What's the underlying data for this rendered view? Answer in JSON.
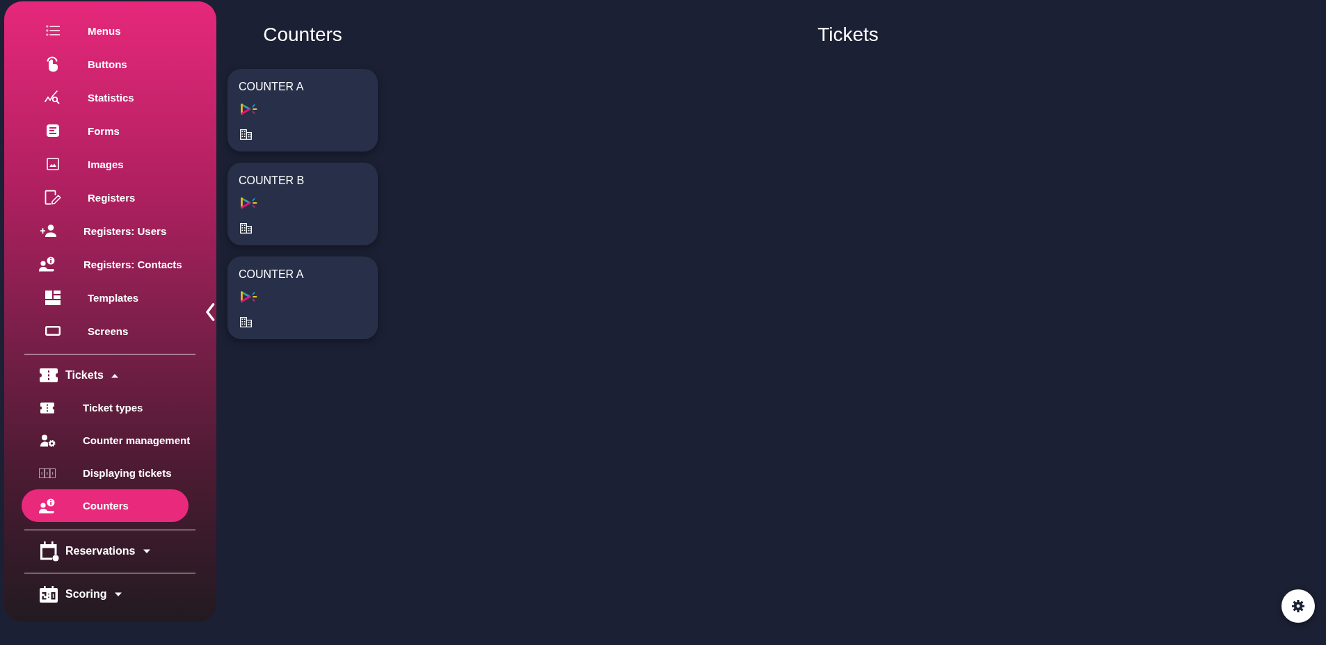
{
  "sidebar": {
    "items": [
      {
        "label": "Menus",
        "selected": false
      },
      {
        "label": "Buttons",
        "selected": false
      },
      {
        "label": "Statistics",
        "selected": false
      },
      {
        "label": "Forms",
        "selected": false
      },
      {
        "label": "Images",
        "selected": false
      },
      {
        "label": "Registers",
        "selected": false
      },
      {
        "label": "Registers: Users",
        "selected": false
      },
      {
        "label": "Registers: Contacts",
        "selected": false
      },
      {
        "label": "Templates",
        "selected": false
      },
      {
        "label": "Screens",
        "selected": false
      }
    ],
    "groups": [
      {
        "label": "Tickets",
        "expanded": true,
        "children": [
          {
            "label": "Ticket types",
            "selected": false
          },
          {
            "label": "Counter management",
            "selected": false
          },
          {
            "label": "Displaying tickets",
            "selected": false
          },
          {
            "label": "Counters",
            "selected": true
          }
        ]
      },
      {
        "label": "Reservations",
        "expanded": false
      },
      {
        "label": "Scoring",
        "expanded": false
      }
    ]
  },
  "counters": {
    "title": "Counters",
    "cards": [
      {
        "name": "COUNTER A"
      },
      {
        "name": "COUNTER B"
      },
      {
        "name": "COUNTER A"
      }
    ]
  },
  "tickets": {
    "title": "Tickets"
  }
}
